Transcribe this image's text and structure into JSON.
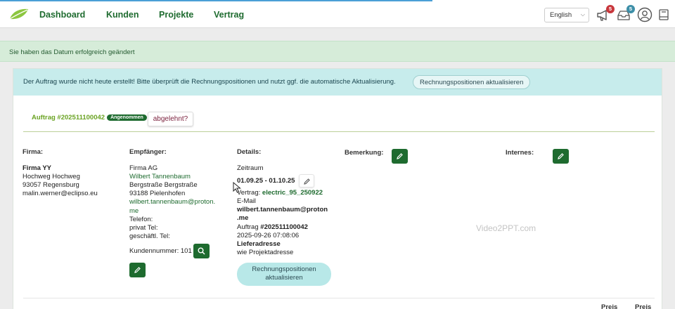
{
  "nav": {
    "links": [
      "Dashboard",
      "Kunden",
      "Projekte",
      "Vertrag"
    ],
    "language": "English",
    "notifications_count": "5",
    "messages_count": "5"
  },
  "colors": {
    "brand_green": "#1e6b2f",
    "accent_light_green": "#6aa323",
    "info_bg": "#c7ecec",
    "success_bg": "#d6ecd9",
    "notification_red": "#c8373c",
    "message_teal": "#3d8fa8"
  },
  "success_message": "Sie haben das Datum erfolgreich geändert",
  "info": {
    "text": "Der Auftrag wurde nicht heute erstellt! Bitte überprüft die Rechnungspositionen und nutzt ggf. die automatische Aktualisierung.",
    "button": "Rechnungspositionen aktualisieren"
  },
  "order": {
    "label": "Auftrag #202511100042",
    "status_badge": "Angenommen",
    "reject_button": "abgelehnt?"
  },
  "firma": {
    "heading": "Firma:",
    "name": "Firma YY",
    "street": "Hochweg Hochweg",
    "city": "93057 Regensburg",
    "email": "malin.werner@eclipso.eu"
  },
  "recipient": {
    "heading": "Empfänger:",
    "company": "Firma AG",
    "contact": "Wilbert Tannenbaum",
    "street": "Bergstraße Bergstraße",
    "city": "93188 Pielenhofen",
    "email_line1": "wilbert.tannenbaum@proton.",
    "email_line2": "me",
    "phone_label": "Telefon:",
    "private_phone": "privat Tel:",
    "business_phone": "geschäftl. Tel:",
    "customer_number": "Kundennummer: 101"
  },
  "details": {
    "heading": "Details:",
    "period_label": "Zeitraum",
    "period_value": "01.09.25 - 01.10.25",
    "contract_label": "Vertrag:",
    "contract_value": "electric_95_250922",
    "email_label": "E-Mail",
    "email_line1": "wilbert.tannenbaum@proton",
    "email_line2": ".me",
    "order_label": "Auftrag",
    "order_value": "#202511100042",
    "timestamp": "2025-09-26 07:08:06",
    "delivery_label": "Lieferadresse",
    "delivery_value": "wie Projektadresse",
    "update_button_line1": "Rechnungspositionen",
    "update_button_line2": "aktualisieren"
  },
  "remarks_heading": "Bemerkung:",
  "internal_heading": "Internes:",
  "watermark": "Video2PPT.com",
  "table_headers": [
    "Preis",
    "Preis"
  ],
  "icons": {
    "logo": "leaf-logo-icon",
    "notifications": "megaphone-icon",
    "messages": "inbox-tray-icon",
    "profile": "user-circle-icon",
    "book": "book-icon",
    "edit": "pencil-icon",
    "search": "search-icon",
    "chevron": "chevron-down-icon"
  }
}
